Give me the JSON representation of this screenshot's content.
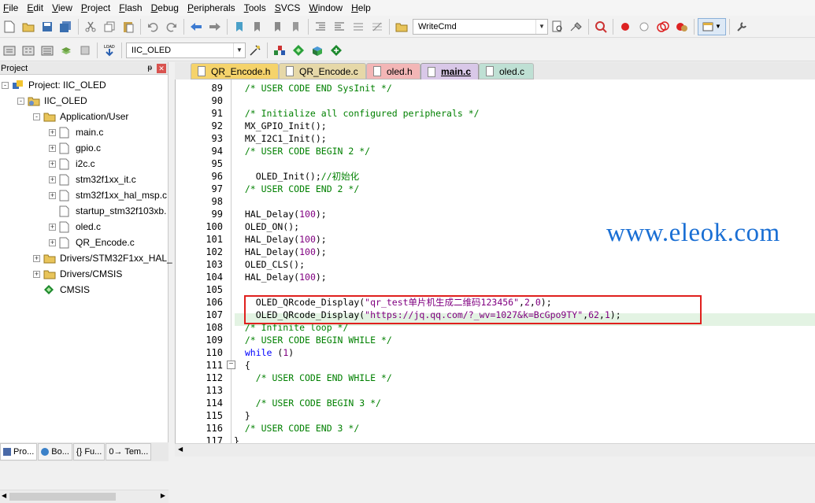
{
  "menu": [
    "File",
    "Edit",
    "View",
    "Project",
    "Flash",
    "Debug",
    "Peripherals",
    "Tools",
    "SVCS",
    "Window",
    "Help"
  ],
  "toolbar": {
    "find_combo_value": "WriteCmd",
    "target_combo_value": "IIC_OLED"
  },
  "project_panel": {
    "title": "Project",
    "tree": [
      {
        "label": "Project: IIC_OLED",
        "level": 0,
        "type": "project",
        "expand": "-"
      },
      {
        "label": "IIC_OLED",
        "level": 1,
        "type": "target",
        "expand": "-"
      },
      {
        "label": "Application/User",
        "level": 2,
        "type": "folder",
        "expand": "-"
      },
      {
        "label": "main.c",
        "level": 3,
        "type": "file",
        "expand": "+"
      },
      {
        "label": "gpio.c",
        "level": 3,
        "type": "file",
        "expand": "+"
      },
      {
        "label": "i2c.c",
        "level": 3,
        "type": "file",
        "expand": "+"
      },
      {
        "label": "stm32f1xx_it.c",
        "level": 3,
        "type": "file",
        "expand": "+"
      },
      {
        "label": "stm32f1xx_hal_msp.c",
        "level": 3,
        "type": "file",
        "expand": "+"
      },
      {
        "label": "startup_stm32f103xb.",
        "level": 3,
        "type": "file",
        "expand": ""
      },
      {
        "label": "oled.c",
        "level": 3,
        "type": "file",
        "expand": "+"
      },
      {
        "label": "QR_Encode.c",
        "level": 3,
        "type": "file",
        "expand": "+"
      },
      {
        "label": "Drivers/STM32F1xx_HAL_",
        "level": 2,
        "type": "folder",
        "expand": "+"
      },
      {
        "label": "Drivers/CMSIS",
        "level": 2,
        "type": "folder",
        "expand": "+"
      },
      {
        "label": "CMSIS",
        "level": 2,
        "type": "component",
        "expand": ""
      }
    ],
    "bottom_tabs": [
      "Pro...",
      "Bo...",
      "{} Fu...",
      "0→ Tem..."
    ]
  },
  "editor_tabs": [
    {
      "label": "QR_Encode.h",
      "color": "#f5d36b"
    },
    {
      "label": "QR_Encode.c",
      "color": "#e6d8a8"
    },
    {
      "label": "oled.h",
      "color": "#f3b6b6"
    },
    {
      "label": "main.c",
      "color": "#d9c8e8",
      "active": true
    },
    {
      "label": "oled.c",
      "color": "#bfe0d4"
    }
  ],
  "code_lines": [
    {
      "n": "89",
      "t": "  /* USER CODE END SysInit */",
      "k": "cm"
    },
    {
      "n": "90",
      "t": "",
      "k": ""
    },
    {
      "n": "91",
      "t": "  /* Initialize all configured peripherals */",
      "k": "cm"
    },
    {
      "n": "92",
      "t": "  MX_GPIO_Init();",
      "k": ""
    },
    {
      "n": "93",
      "t": "  MX_I2C1_Init();",
      "k": ""
    },
    {
      "n": "94",
      "t": "  /* USER CODE BEGIN 2 */",
      "k": "cm"
    },
    {
      "n": "95",
      "t": "",
      "k": ""
    },
    {
      "n": "96",
      "t": "    OLED_Init();//初始化",
      "k": "initline"
    },
    {
      "n": "97",
      "t": "  /* USER CODE END 2 */",
      "k": "cm"
    },
    {
      "n": "98",
      "t": "",
      "k": ""
    },
    {
      "n": "99",
      "t": "  HAL_Delay(100);",
      "k": "delay"
    },
    {
      "n": "100",
      "t": "  OLED_ON();",
      "k": ""
    },
    {
      "n": "101",
      "t": "  HAL_Delay(100);",
      "k": "delay"
    },
    {
      "n": "102",
      "t": "  HAL_Delay(100);",
      "k": "delay"
    },
    {
      "n": "103",
      "t": "  OLED_CLS();",
      "k": ""
    },
    {
      "n": "104",
      "t": "  HAL_Delay(100);",
      "k": "delay"
    },
    {
      "n": "105",
      "t": "",
      "k": ""
    },
    {
      "n": "106",
      "t": "    OLED_QRcode_Display(\"qr_test单片机生成二维码123456\",2,0);",
      "k": "qr1"
    },
    {
      "n": "107",
      "t": "    OLED_QRcode_Display(\"https://jq.qq.com/?_wv=1027&k=BcGpo9TY\",62,1);",
      "k": "qr2"
    },
    {
      "n": "108",
      "t": "  /* Infinite loop */",
      "k": "cm"
    },
    {
      "n": "109",
      "t": "  /* USER CODE BEGIN WHILE */",
      "k": "cm"
    },
    {
      "n": "110",
      "t": "  while (1)",
      "k": "while"
    },
    {
      "n": "111",
      "t": "  {",
      "k": ""
    },
    {
      "n": "112",
      "t": "    /* USER CODE END WHILE */",
      "k": "cm"
    },
    {
      "n": "113",
      "t": "",
      "k": ""
    },
    {
      "n": "114",
      "t": "    /* USER CODE BEGIN 3 */",
      "k": "cm"
    },
    {
      "n": "115",
      "t": "  }",
      "k": ""
    },
    {
      "n": "116",
      "t": "  /* USER CODE END 3 */",
      "k": "cm"
    },
    {
      "n": "117",
      "t": "}",
      "k": ""
    }
  ],
  "watermark": "www.eleok.com"
}
